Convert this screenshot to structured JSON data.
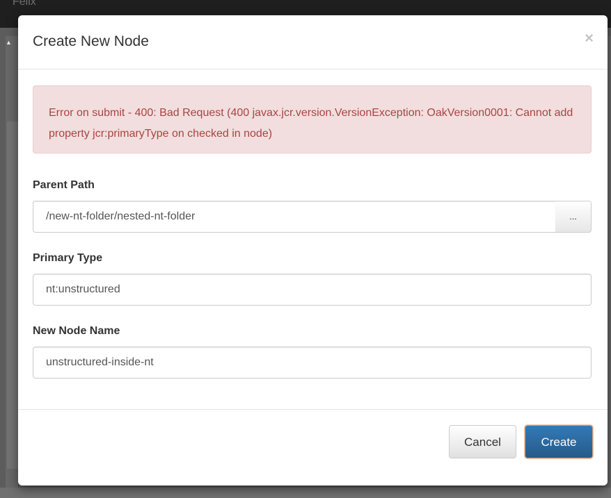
{
  "background": {
    "brand_text": "Felix"
  },
  "modal": {
    "title": "Create New Node",
    "close_glyph": "×",
    "error_message": "Error on submit - 400: Bad Request (400 javax.jcr.version.VersionException: OakVersion0001: Cannot add property jcr:primaryType on checked in node)",
    "fields": {
      "parent_path": {
        "label": "Parent Path",
        "value": "/new-nt-folder/nested-nt-folder",
        "browse_label": "..."
      },
      "primary_type": {
        "label": "Primary Type",
        "value": "nt:unstructured"
      },
      "node_name": {
        "label": "New Node Name",
        "value": "unstructured-inside-nt"
      }
    },
    "footer": {
      "cancel_label": "Cancel",
      "create_label": "Create"
    }
  },
  "colors": {
    "error_text": "#a94442",
    "error_bg": "#f2dede",
    "primary_button": "#286090"
  }
}
